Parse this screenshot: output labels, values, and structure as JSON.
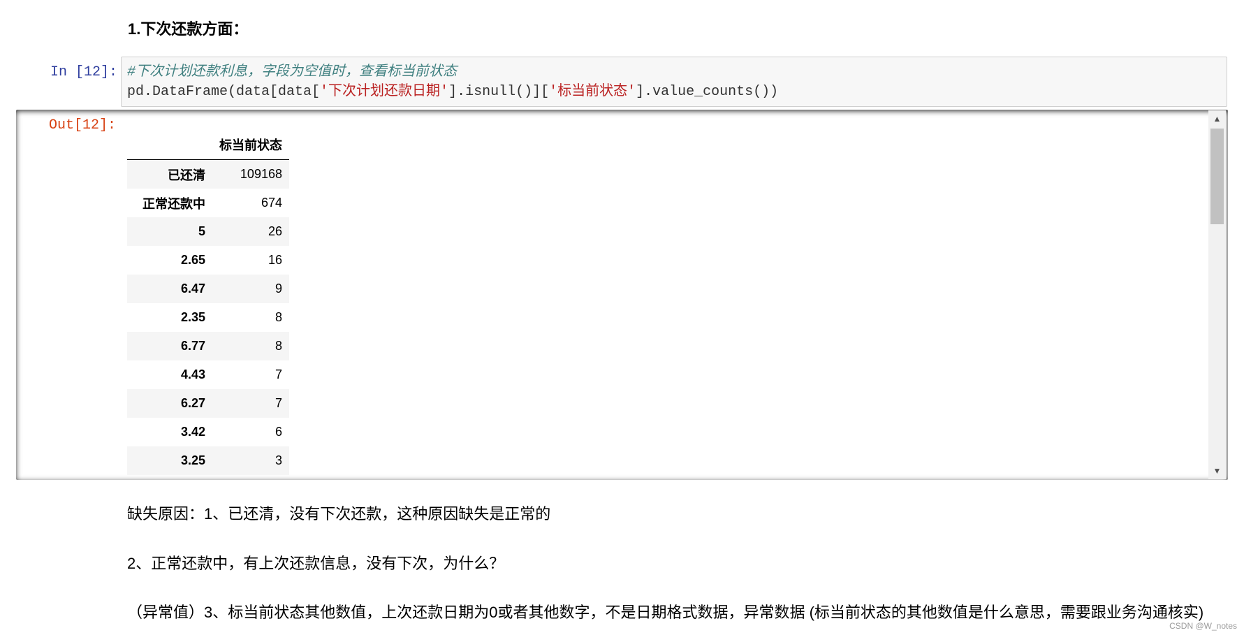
{
  "heading": "1.下次还款方面：",
  "input_cell": {
    "prompt": "In  [12]:",
    "comment": "#下次计划还款利息，字段为空值时，查看标当前状态",
    "code_prefix": "pd.DataFrame(data[data[",
    "str1": "'下次计划还款日期'",
    "code_mid": "].isnull()][",
    "str2": "'标当前状态'",
    "code_suffix": "].value_counts())"
  },
  "output_cell": {
    "prompt": "Out[12]:",
    "column_header": "标当前状态",
    "rows": [
      {
        "index": "已还清",
        "value": "109168"
      },
      {
        "index": "正常还款中",
        "value": "674"
      },
      {
        "index": "5",
        "value": "26"
      },
      {
        "index": "2.65",
        "value": "16"
      },
      {
        "index": "6.47",
        "value": "9"
      },
      {
        "index": "2.35",
        "value": "8"
      },
      {
        "index": "6.77",
        "value": "8"
      },
      {
        "index": "4.43",
        "value": "7"
      },
      {
        "index": "6.27",
        "value": "7"
      },
      {
        "index": "3.42",
        "value": "6"
      },
      {
        "index": "3.25",
        "value": "3"
      }
    ]
  },
  "notes": [
    "缺失原因：1、已还清，没有下次还款，这种原因缺失是正常的",
    "2、正常还款中，有上次还款信息，没有下次，为什么？",
    "（异常值）3、标当前状态其他数值，上次还款日期为0或者其他数字，不是日期格式数据，异常数据 (标当前状态的其他数值是什么意思，需要跟业务沟通核实)"
  ],
  "scrollbar": {
    "up_icon": "▲",
    "down_icon": "▼"
  },
  "watermark": "CSDN @W_notes"
}
